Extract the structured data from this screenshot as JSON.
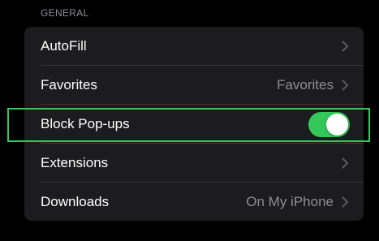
{
  "section": {
    "header": "GENERAL"
  },
  "rows": [
    {
      "label": "AutoFill",
      "value": "",
      "control": "chevron"
    },
    {
      "label": "Favorites",
      "value": "Favorites",
      "control": "chevron"
    },
    {
      "label": "Block Pop-ups",
      "value": "",
      "control": "toggle",
      "toggle_on": true
    },
    {
      "label": "Extensions",
      "value": "",
      "control": "chevron"
    },
    {
      "label": "Downloads",
      "value": "On My iPhone",
      "control": "chevron"
    }
  ],
  "colors": {
    "background": "#000000",
    "group_background": "#1c1c1e",
    "separator": "#38383a",
    "primary_text": "#ffffff",
    "secondary_text": "#8d8d93",
    "toggle_on": "#34c759",
    "highlight_border": "#34c759"
  },
  "icons": {
    "disclosure": "chevron-right-icon"
  }
}
